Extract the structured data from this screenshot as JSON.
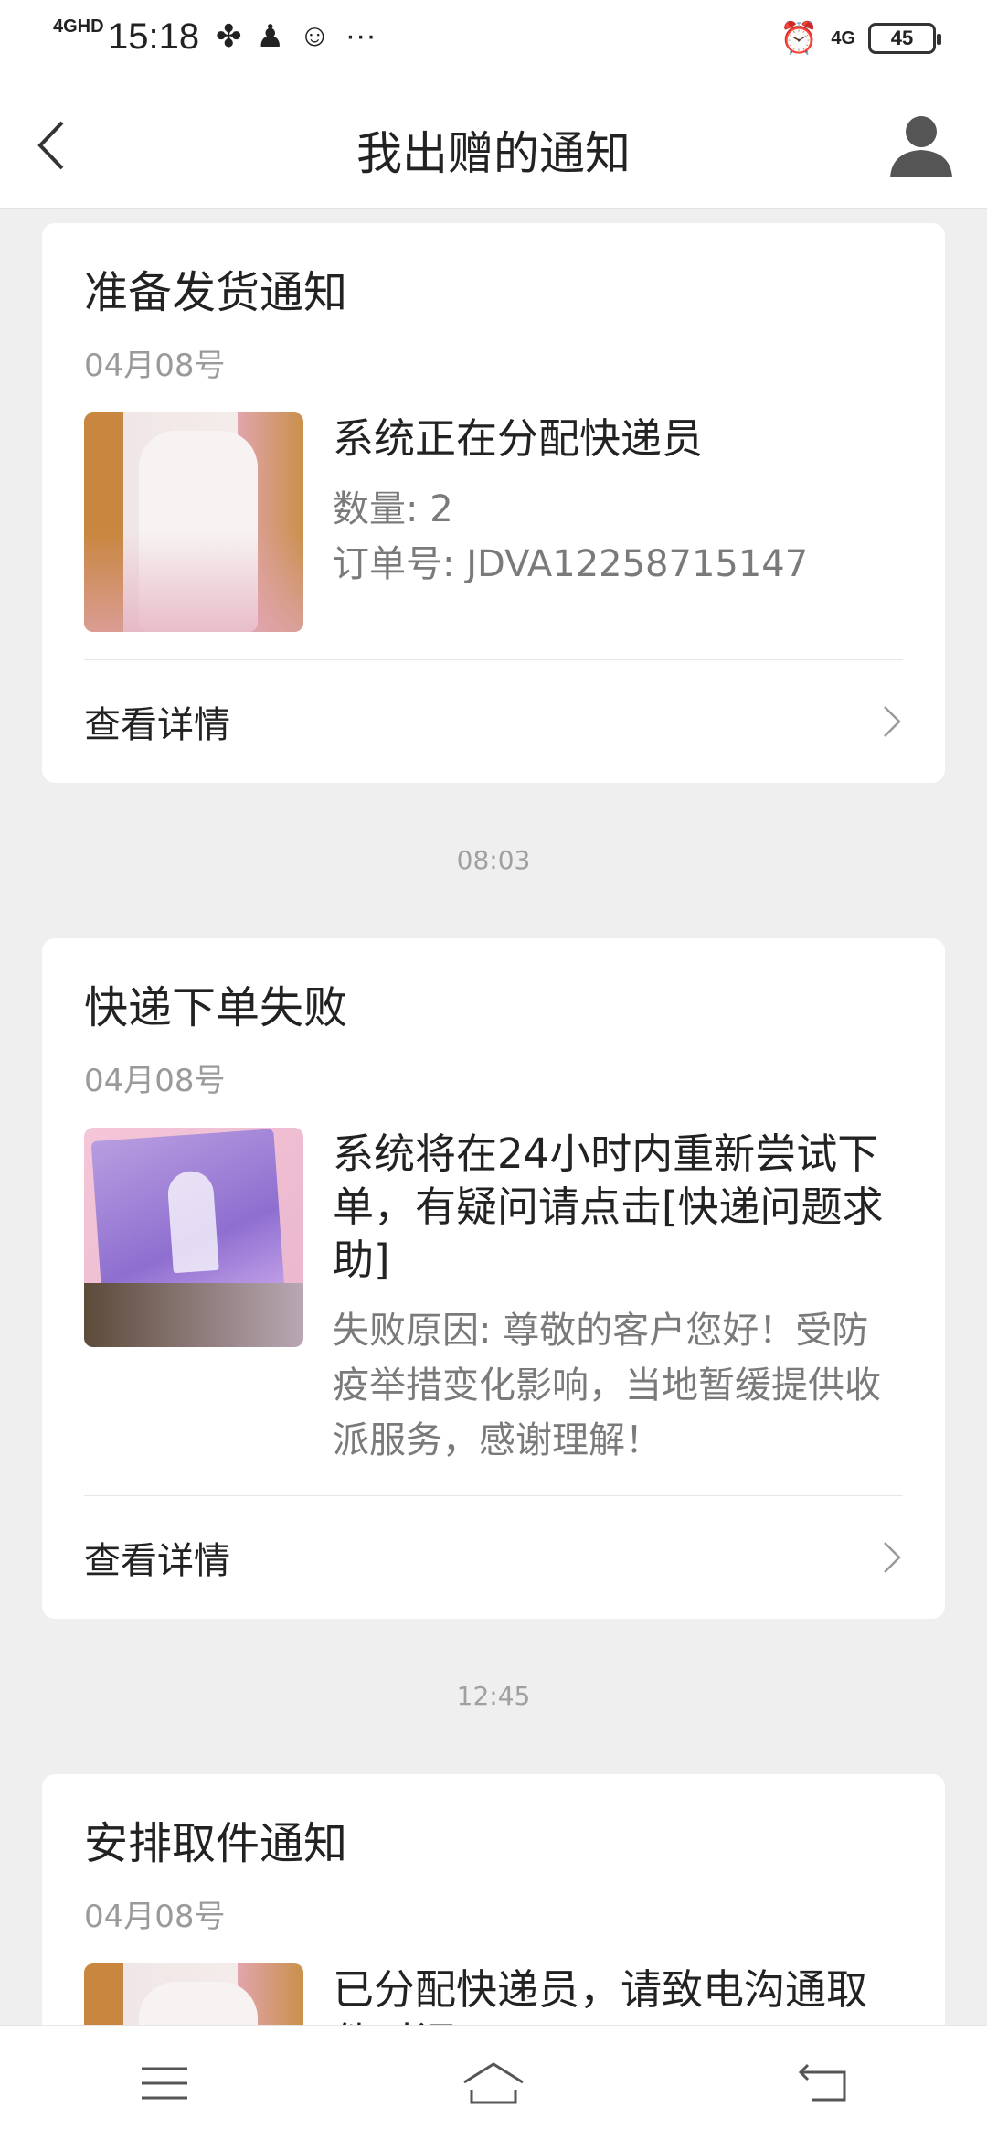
{
  "status_bar": {
    "network": "4GHD",
    "time": "15:18",
    "network_right": "4G",
    "battery": "45"
  },
  "header": {
    "title": "我出赠的通知"
  },
  "cards": [
    {
      "title": "准备发货通知",
      "date": "04月08号",
      "main": "系统正在分配快递员",
      "sub": [
        "数量: 2",
        "订单号: JDVA12258715147"
      ],
      "detail": "查看详情"
    },
    {
      "title": "快递下单失败",
      "date": "04月08号",
      "main": "系统将在24小时内重新尝试下单，有疑问请点击[快递问题求助]",
      "sub": [
        "失败原因: 尊敬的客户您好！受防疫举措变化影响，当地暂缓提供收派服务，感谢理解！"
      ],
      "detail": "查看详情"
    },
    {
      "title": "安排取件通知",
      "date": "04月08号",
      "main": "已分配快递员，请致电沟通取件时间"
    }
  ],
  "timestamps": [
    "08:03",
    "12:45"
  ],
  "icons": {
    "back": "back-arrow-icon",
    "user": "user-icon",
    "chevron": "chevron-right-icon",
    "menu": "menu-icon",
    "home": "home-icon",
    "return": "return-icon"
  },
  "colors": {
    "background": "#efefef",
    "card": "#ffffff",
    "text_primary": "#222222",
    "text_secondary": "#7a7a7a",
    "date": "#9a9a9a"
  }
}
